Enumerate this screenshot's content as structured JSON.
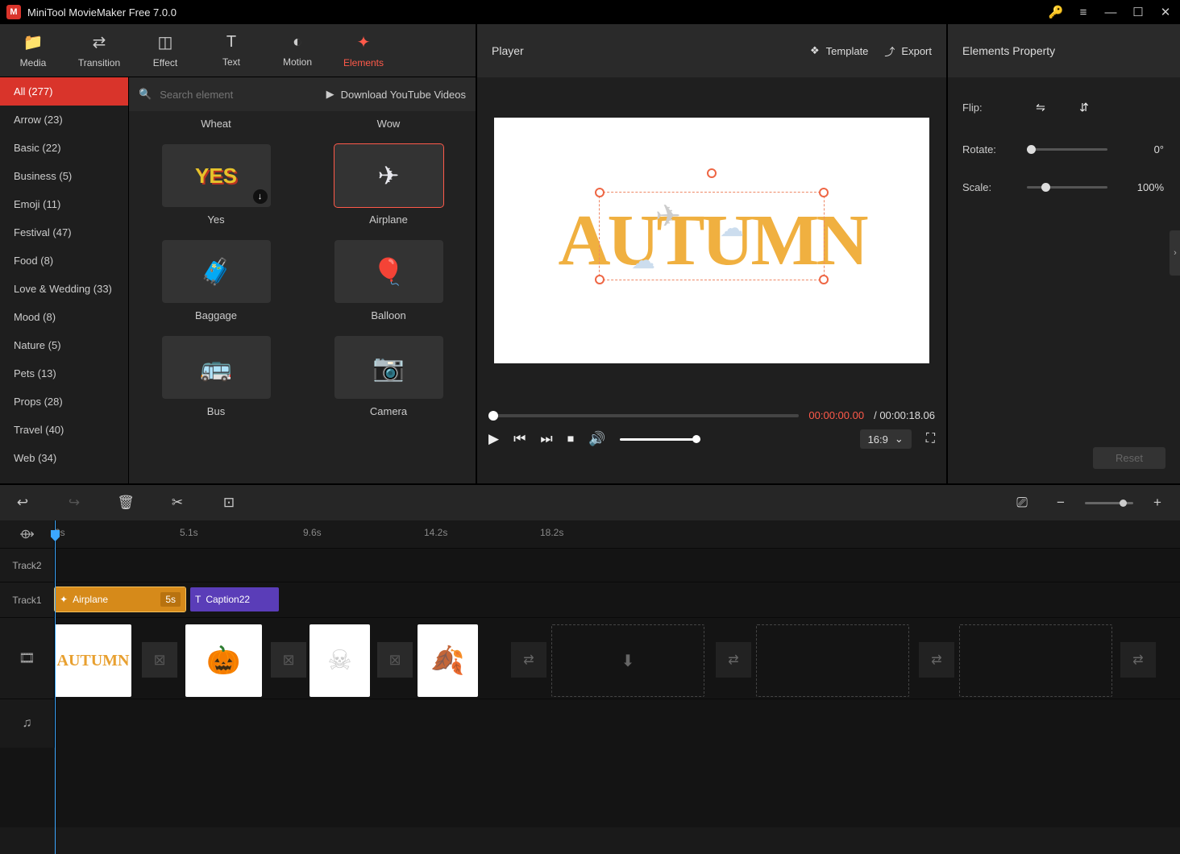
{
  "app": {
    "title": "MiniTool MovieMaker Free 7.0.0"
  },
  "tabs": {
    "media": "Media",
    "transition": "Transition",
    "effect": "Effect",
    "text": "Text",
    "motion": "Motion",
    "elements": "Elements"
  },
  "categories": [
    {
      "label": "All (277)",
      "active": true
    },
    {
      "label": "Arrow (23)"
    },
    {
      "label": "Basic (22)"
    },
    {
      "label": "Business (5)"
    },
    {
      "label": "Emoji (11)"
    },
    {
      "label": "Festival (47)"
    },
    {
      "label": "Food (8)"
    },
    {
      "label": "Love & Wedding (33)"
    },
    {
      "label": "Mood (8)"
    },
    {
      "label": "Nature (5)"
    },
    {
      "label": "Pets (13)"
    },
    {
      "label": "Props (28)"
    },
    {
      "label": "Travel (40)"
    },
    {
      "label": "Web (34)"
    }
  ],
  "search": {
    "placeholder": "Search element"
  },
  "download_yt": "Download YouTube Videos",
  "prev_row": {
    "left": "Wheat",
    "right": "Wow"
  },
  "elements": [
    {
      "name": "Yes",
      "glyph": "YES",
      "style": "color:#e6c32b;font-weight:900;font-size:26px;text-shadow:2px 2px 0 #b32;"
    },
    {
      "name": "Airplane",
      "glyph": "✈",
      "selected": true,
      "style": "color:#e8e8ee;"
    },
    {
      "name": "Baggage",
      "glyph": "🧳",
      "style": ""
    },
    {
      "name": "Balloon",
      "glyph": "🎈",
      "style": ""
    },
    {
      "name": "Bus",
      "glyph": "🚌",
      "style": ""
    },
    {
      "name": "Camera",
      "glyph": "📷",
      "style": ""
    }
  ],
  "player": {
    "title": "Player",
    "template": "Template",
    "export": "Export",
    "time_cur": "00:00:00.00",
    "time_dur": "/ 00:00:18.06",
    "aspect": "16:9",
    "preview_text": "AUTUMN"
  },
  "props": {
    "title": "Elements Property",
    "flip_label": "Flip:",
    "rotate_label": "Rotate:",
    "rotate_value": "0°",
    "scale_label": "Scale:",
    "scale_value": "100%",
    "reset": "Reset"
  },
  "timeline": {
    "marks": [
      "0s",
      "5.1s",
      "9.6s",
      "14.2s",
      "18.2s"
    ],
    "track2": "Track2",
    "track1": "Track1",
    "clips": {
      "airplane": "Airplane",
      "airplane_dur": "5s",
      "caption": "Caption22"
    }
  }
}
